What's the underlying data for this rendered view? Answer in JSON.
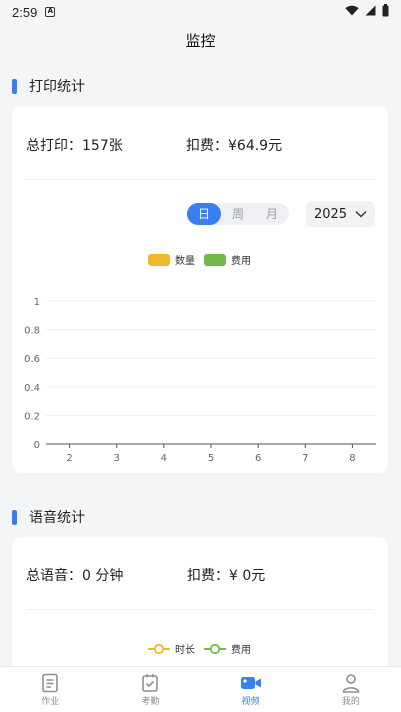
{
  "status": {
    "time": "2:59",
    "notif_badge": "A"
  },
  "header": {
    "title": "监控"
  },
  "print_section": {
    "title": "打印统计",
    "total_label": "总打印：157张",
    "fee_label": "扣费：¥64.9元",
    "segments": [
      "日",
      "周",
      "月"
    ],
    "active_segment": "日",
    "year": "2025",
    "legend": [
      {
        "name": "数量",
        "color": "#f1b92a"
      },
      {
        "name": "费用",
        "color": "#72bb4b"
      }
    ]
  },
  "voice_section": {
    "title": "语音统计",
    "total_label": "总语音：",
    "total_value": "0 分钟",
    "fee_label": "扣费：",
    "fee_value": "¥ 0元",
    "legend": [
      {
        "name": "时长",
        "color": "#f1b92a"
      },
      {
        "name": "费用",
        "color": "#72bb4b"
      }
    ]
  },
  "chart_data": {
    "type": "bar",
    "categories": [
      "2",
      "3",
      "4",
      "5",
      "6",
      "7",
      "8"
    ],
    "series": [
      {
        "name": "数量",
        "values": [
          0,
          0,
          0,
          0,
          0,
          0,
          0
        ]
      },
      {
        "name": "费用",
        "values": [
          0,
          0,
          0,
          0,
          0,
          0,
          0
        ]
      }
    ],
    "ylim": [
      0,
      1
    ],
    "yticks": [
      "0",
      "0.2",
      "0.4",
      "0.6",
      "0.8",
      "1"
    ],
    "grid": true,
    "legend": "top-center",
    "colors": [
      "#f1b92a",
      "#72bb4b"
    ]
  },
  "tabs": [
    {
      "label": "作业",
      "icon": "document-icon",
      "active": false
    },
    {
      "label": "考勤",
      "icon": "checkbox-icon",
      "active": false
    },
    {
      "label": "视频",
      "icon": "video-camera-icon",
      "active": true
    },
    {
      "label": "我的",
      "icon": "user-icon",
      "active": false
    }
  ],
  "colors": {
    "accent": "#3a7ff0",
    "background": "#f4f5f7"
  }
}
